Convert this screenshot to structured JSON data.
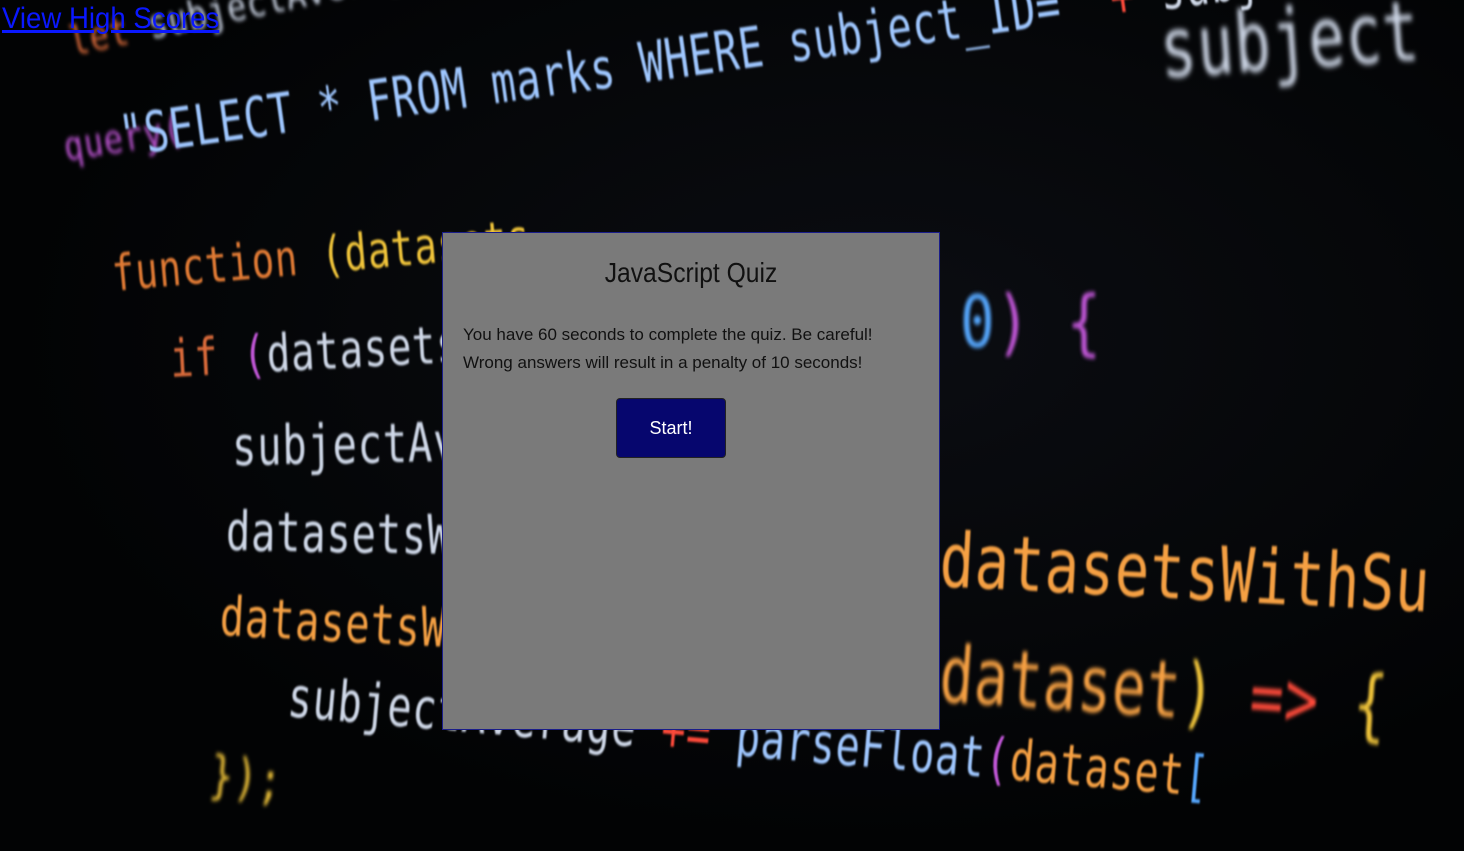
{
  "header": {
    "high_scores_link": "View High Scores"
  },
  "quiz": {
    "title": "JavaScript Quiz",
    "description": "You have 60 seconds to complete the quiz. Be careful! Wrong answers will result in a penalty of 10 seconds!",
    "start_label": "Start!"
  },
  "background_code": {
    "lines": [
      "let subjectAverage;",
      "query(",
      "\"SELECT * FROM marks WHERE subject_ID=\" + subject",
      "function (datasets",
      "if (datasetsWit",
      "subjectAver",
      "datasetsWit",
      "datasetsWit",
      "subjectAverage += parseFloat(dataset[",
      "});",
      "0) {",
      "datasetsWithSu",
      "dataset) => {"
    ]
  },
  "colors": {
    "card_bg": "#7a7a7a",
    "card_border": "#1a1d8a",
    "button_bg": "#06066e",
    "link": "#0a18ff"
  }
}
